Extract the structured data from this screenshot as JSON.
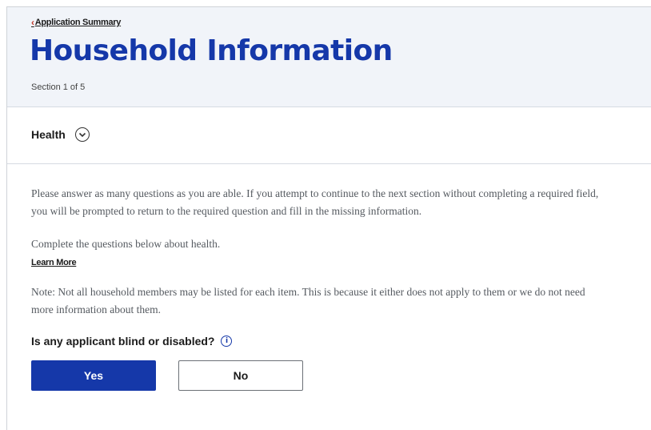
{
  "header": {
    "breadcrumb_label": "Application Summary",
    "title": "Household Information",
    "section_count": "Section 1 of 5"
  },
  "subheader": {
    "title": "Health"
  },
  "content": {
    "intro": "Please answer as many questions as you are able. If you attempt to continue to the next section without completing a required field, you will be prompted to return to the required question and fill in the missing information.",
    "complete": "Complete the questions below about health.",
    "learn_more": "Learn More",
    "note": "Note: Not all household members may be listed for each item. This is because it either does not apply to them or we do not need more information about them."
  },
  "question": {
    "label": "Is any applicant blind or disabled?",
    "yes_label": "Yes",
    "no_label": "No"
  },
  "colors": {
    "brand_blue": "#1538a9",
    "header_bg": "#f1f4f9"
  },
  "icons": {
    "breadcrumb": "chevron-left-icon",
    "section_toggle": "chevron-down-circle-icon",
    "help": "info-icon"
  }
}
